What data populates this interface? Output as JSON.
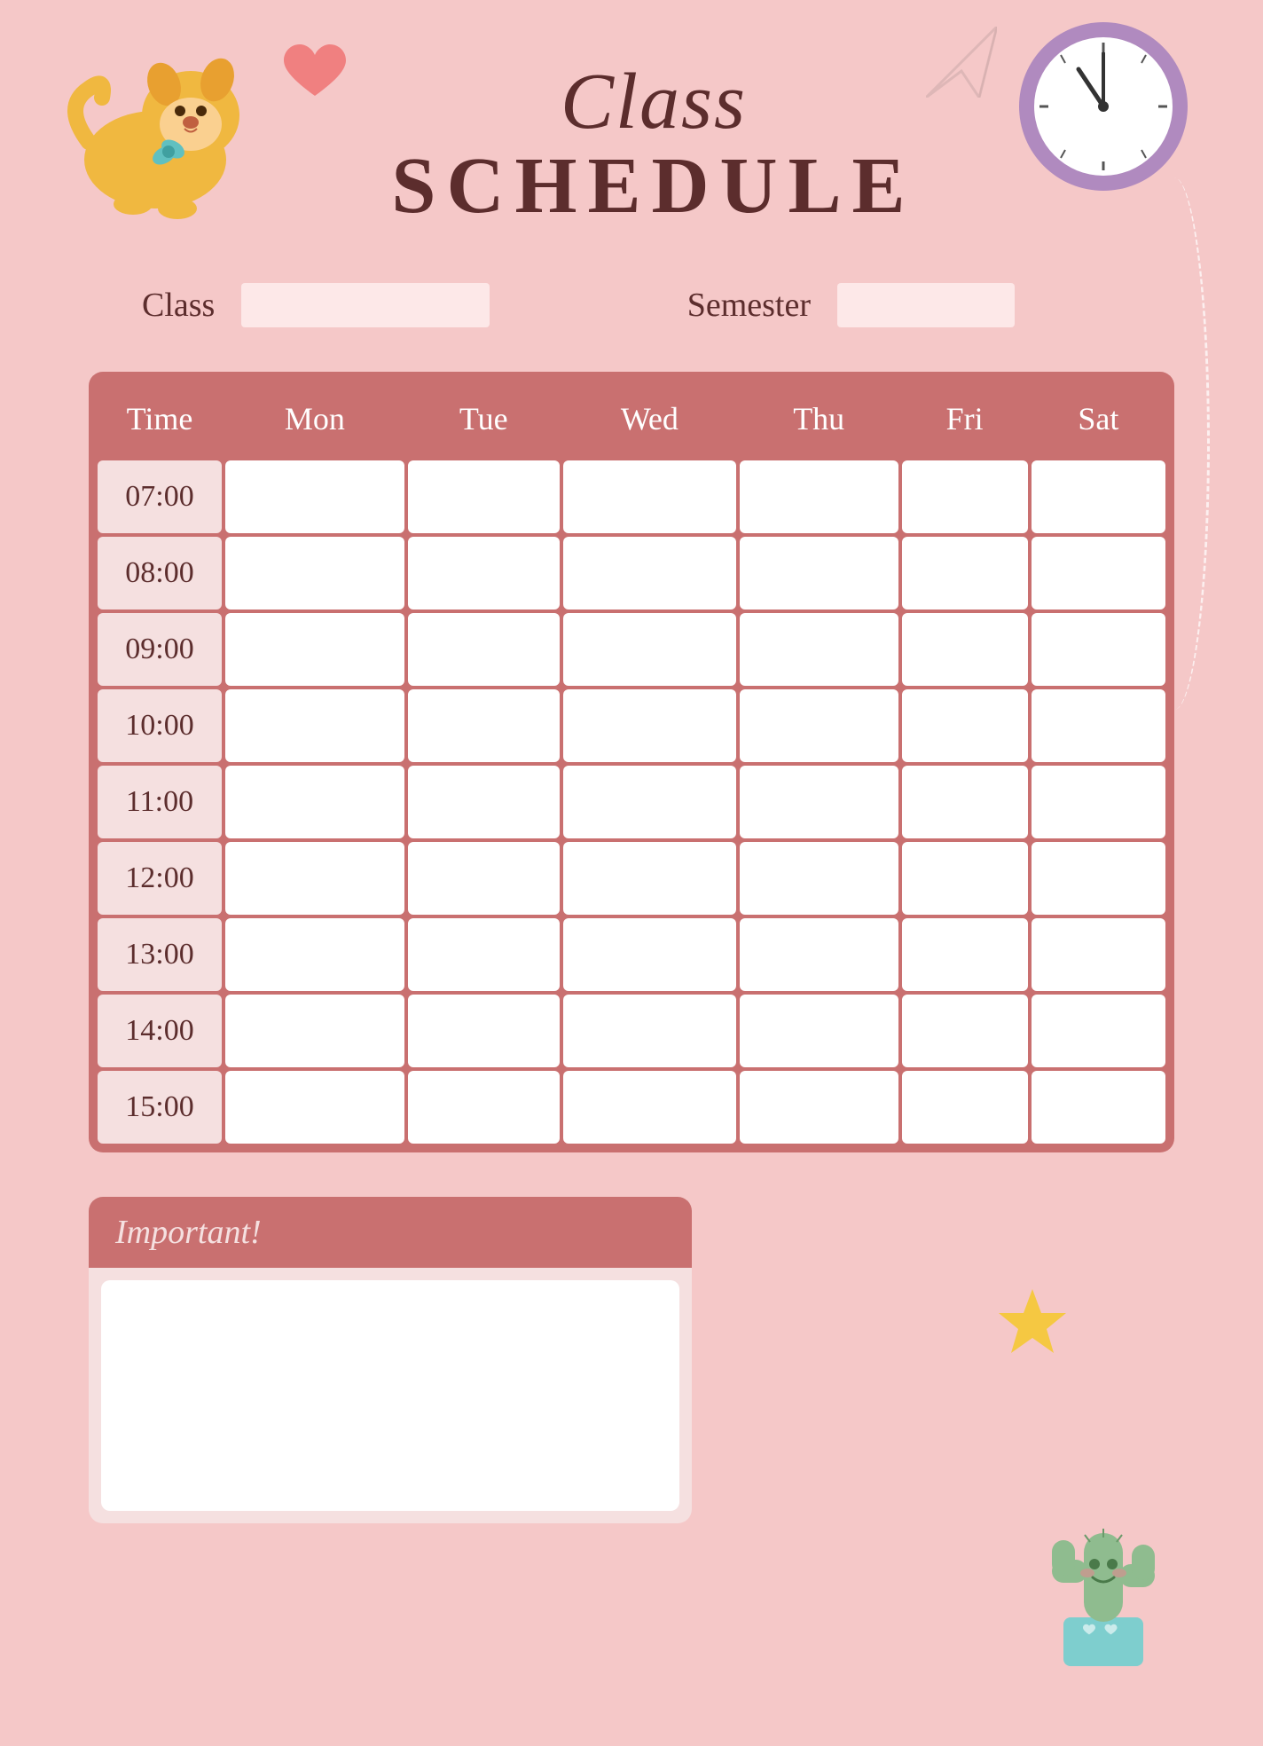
{
  "header": {
    "title_line1": "Class",
    "title_line2": "SCHEDULE"
  },
  "info": {
    "class_label": "Class",
    "class_value": "",
    "semester_label": "Semester",
    "semester_value": ""
  },
  "table": {
    "headers": [
      "Time",
      "Mon",
      "Tue",
      "Wed",
      "Thu",
      "Fri",
      "Sat"
    ],
    "rows": [
      {
        "time": "07:00"
      },
      {
        "time": "08:00"
      },
      {
        "time": "09:00"
      },
      {
        "time": "10:00"
      },
      {
        "time": "11:00"
      },
      {
        "time": "12:00"
      },
      {
        "time": "13:00"
      },
      {
        "time": "14:00"
      },
      {
        "time": "15:00"
      }
    ]
  },
  "important": {
    "label": "Important!"
  },
  "colors": {
    "bg": "#f5c8c8",
    "header_text": "#5c2d2d",
    "table_header_bg": "#c97070",
    "time_cell_bg": "#f5e0e0",
    "data_cell_bg": "#ffffff",
    "important_header_bg": "#c97070"
  }
}
